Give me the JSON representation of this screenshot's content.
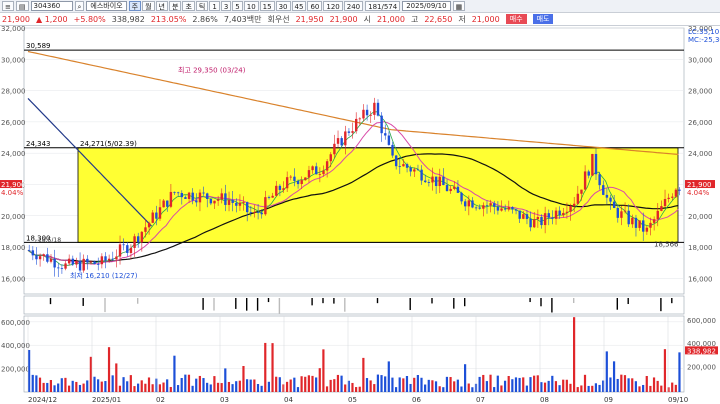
{
  "toolbar": {
    "code": "304360",
    "stock_name": "에스바이오",
    "period_buttons": [
      "주",
      "월",
      "년",
      "분",
      "초",
      "틱",
      "1",
      "3",
      "5",
      "10",
      "15",
      "30",
      "45",
      "60",
      "120",
      "240"
    ],
    "counter": "181/574",
    "date": "2025/09/10"
  },
  "infobar": {
    "price": "21,900",
    "change": "▲ 1,200",
    "change_pct": "+5.80%",
    "volume": "338,982",
    "vol_ratio": "213.05%",
    "turnover_label": "2.86%",
    "trade_value": "7,403백만",
    "market_cap_label": "회우선",
    "ask": "21,950",
    "bid": "21,900",
    "open_label": "시",
    "open": "21,000",
    "high_label": "고",
    "high": "22,650",
    "low_label": "저",
    "low": "21,000",
    "buy_label": "매수",
    "sell_label": "매도"
  },
  "colors": {
    "up": "#e0262a",
    "down": "#1c4fd8",
    "box_fill": "#ffff33",
    "ma_long": "#d9822b",
    "ma_mid": "#111111",
    "ma_short": "#d94aa8"
  },
  "chart_data": {
    "type": "candlestick",
    "y_ticks": [
      "32,000",
      "30,000",
      "28,000",
      "26,000",
      "24,000",
      "22,000",
      "20,000",
      "18,000",
      "16,000"
    ],
    "ylim": [
      15000,
      32000
    ],
    "x_labels": [
      "2024/12",
      "2025/01",
      "02",
      "03",
      "04",
      "05",
      "06",
      "07",
      "08",
      "09",
      "09/10"
    ],
    "hlines": [
      {
        "value": 30589,
        "label": "30,589"
      },
      {
        "value": 24343,
        "label": "24,343"
      },
      {
        "value": 18300,
        "label": "18,300"
      }
    ],
    "box": {
      "y_top": 24343,
      "y_bottom": 18300,
      "label_top": "24,271(5/02.39)",
      "label_low": "18,566"
    },
    "annotations": [
      {
        "text": "최고 29,350 (03/24)",
        "value": 29350
      },
      {
        "text": "최저 16,210 (12/27)",
        "value": 16210
      },
      {
        "text": "18,5/18",
        "value": 18500
      }
    ],
    "right_labels": {
      "top1": "LC:35,10",
      "top2": "MC:-25,30",
      "price": "21,900",
      "pct": "4.04%"
    },
    "volume_ticks": [
      "600,000",
      "400,000",
      "200,000"
    ],
    "volume_right": [
      "600,000",
      "400,000",
      "338,982",
      "200,000"
    ],
    "last_volume": 338982
  }
}
